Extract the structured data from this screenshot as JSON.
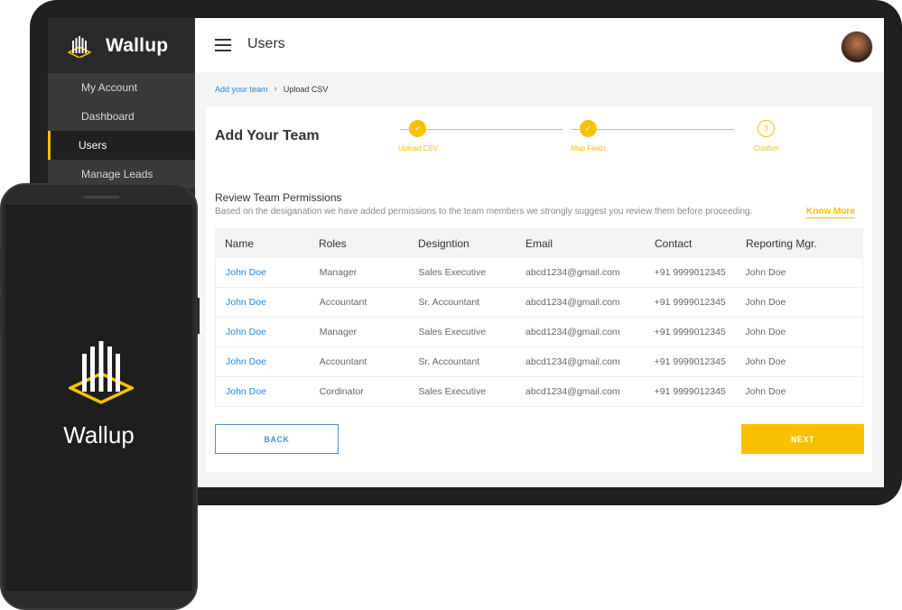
{
  "app": {
    "name": "Wallup"
  },
  "colors": {
    "accent": "#f7c100",
    "link": "#1e88e5",
    "sidebar": "#2a2a2c"
  },
  "sidebar": {
    "items": [
      {
        "label": "My Account",
        "active": false
      },
      {
        "label": "Dashboard",
        "active": false
      },
      {
        "label": "Users",
        "active": true
      },
      {
        "label": "Manage Leads",
        "active": false
      }
    ]
  },
  "header": {
    "title": "Users",
    "menu_icon": "hamburger-icon",
    "avatar_icon": "avatar"
  },
  "breadcrumb": {
    "parent": "Add your team",
    "current": "Upload CSV"
  },
  "card": {
    "title": "Add Your Team",
    "steps": [
      {
        "label": "Upload CSV",
        "status": "done",
        "marker": "✓"
      },
      {
        "label": "Map Fields",
        "status": "done",
        "marker": "✓"
      },
      {
        "label": "Confirm",
        "status": "pending",
        "marker": "3"
      }
    ],
    "permissions_title": "Review Team Permissions",
    "permissions_desc": "Based on the desiganation we have added permissions to the team members we strongly suggest you review them before proceeding.",
    "know_more": "Know More"
  },
  "table": {
    "headers": [
      "Name",
      "Roles",
      "Designtion",
      "Email",
      "Contact",
      "Reporting Mgr."
    ],
    "rows": [
      [
        "John Doe",
        "Manager",
        "Sales Executive",
        "abcd1234@gmail.com",
        "+91 9999012345",
        "John Doe"
      ],
      [
        "John Doe",
        "Accountant",
        "Sr. Accountant",
        "abcd1234@gmail.com",
        "+91 9999012345",
        "John Doe"
      ],
      [
        "John Doe",
        "Manager",
        "Sales Executive",
        "abcd1234@gmail.com",
        "+91 9999012345",
        "John Doe"
      ],
      [
        "John Doe",
        "Accountant",
        "Sr. Accountant",
        "abcd1234@gmail.com",
        "+91 9999012345",
        "John Doe"
      ],
      [
        "John Doe",
        "Cordinator",
        "Sales Executive",
        "abcd1234@gmail.com",
        "+91 9999012345",
        "John Doe"
      ]
    ]
  },
  "buttons": {
    "back": "BACK",
    "next": "NEXT"
  },
  "phone": {
    "app_name": "Wallup"
  }
}
